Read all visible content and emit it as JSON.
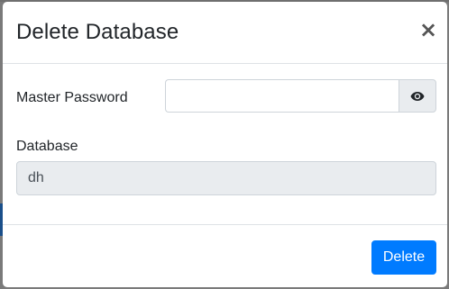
{
  "modal": {
    "title": "Delete Database",
    "close_symbol": "×",
    "fields": {
      "master_password": {
        "label": "Master Password",
        "value": "",
        "placeholder": "",
        "toggle_icon": "eye-icon"
      },
      "database": {
        "label": "Database",
        "value": "dh"
      }
    },
    "footer": {
      "delete_label": "Delete"
    }
  },
  "colors": {
    "primary": "#007bff",
    "readonly_bg": "#e9ecef",
    "border": "#ced4da"
  }
}
